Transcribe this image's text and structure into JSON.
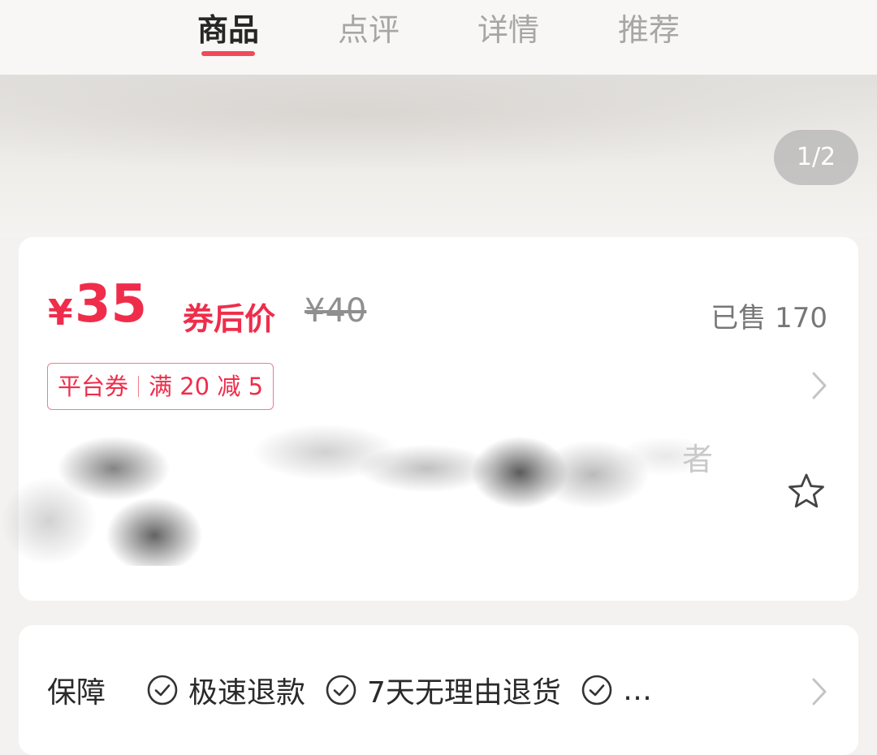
{
  "tabs": [
    {
      "label": "商品",
      "active": true
    },
    {
      "label": "点评",
      "active": false
    },
    {
      "label": "详情",
      "active": false
    },
    {
      "label": "推荐",
      "active": false
    }
  ],
  "gallery": {
    "page_indicator": "1/2"
  },
  "product": {
    "currency_symbol": "¥",
    "price": "35",
    "price_label": "券后价",
    "original_price": "¥40",
    "sold": "已售 170",
    "coupon": {
      "type": "平台券",
      "rule": "满 20 减 5"
    },
    "title_visible_fragment": "者"
  },
  "guarantee": {
    "label": "保障",
    "items": [
      "极速退款",
      "7天无理由退货"
    ],
    "more": "…"
  },
  "colors": {
    "accent": "#ef2d4b",
    "tab_indicator": "#f0495a"
  },
  "icons": [
    "chevron-right-icon",
    "star-outline-icon",
    "check-circle-icon"
  ]
}
